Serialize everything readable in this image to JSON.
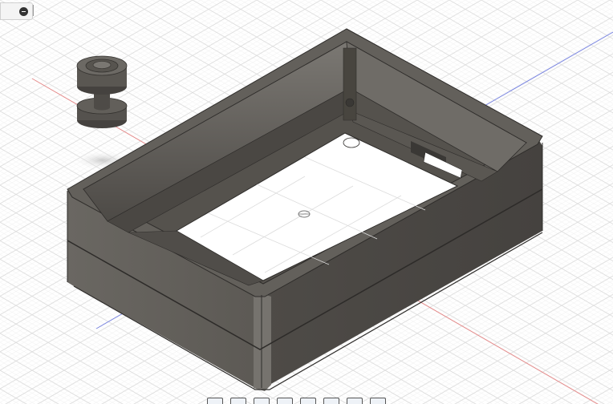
{
  "canvas": {
    "background": "#ffffff",
    "grid_color": "#d6d6d6",
    "x_axis_color": "#e06060",
    "y_axis_color": "#5a6ad8"
  },
  "browser_panel": {
    "collapse_icon": "minus-circle-icon"
  },
  "model": {
    "enclosure_color": "#5b5853",
    "knob_color": "#55524e"
  },
  "navigation_bar": {
    "tools": [
      "orbit-icon",
      "pan-icon",
      "look-at-icon",
      "zoom-icon",
      "fit-icon",
      "display-settings-icon",
      "grid-settings-icon",
      "viewports-icon"
    ]
  }
}
